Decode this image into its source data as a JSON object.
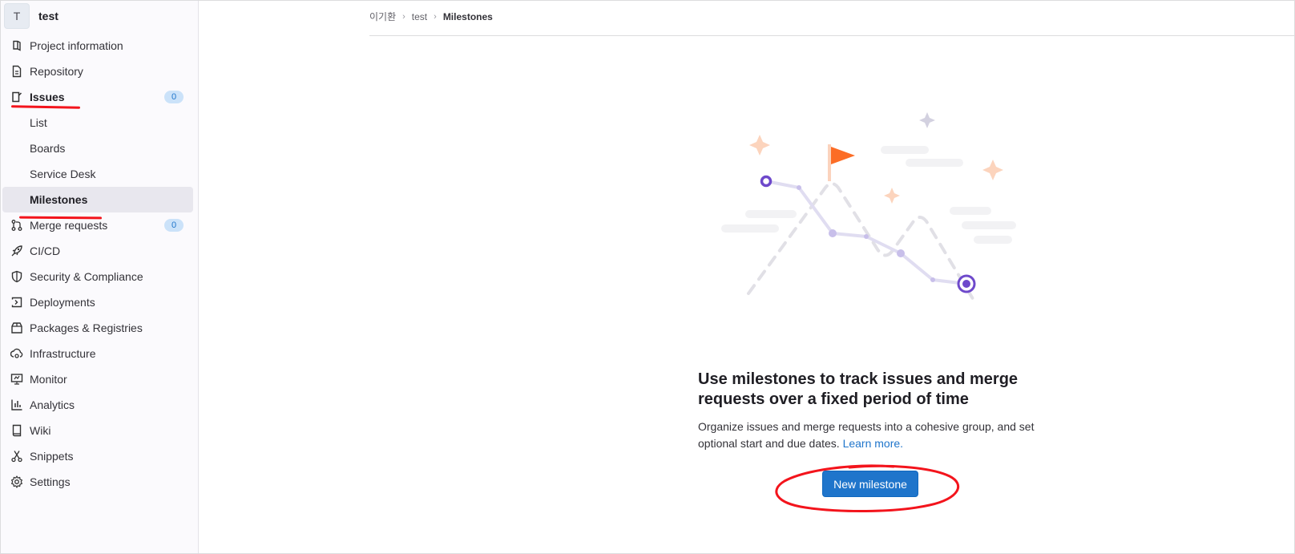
{
  "project": {
    "avatar_letter": "T",
    "name": "test"
  },
  "sidebar": {
    "items": [
      {
        "label": "Project information",
        "icon": "info-icon"
      },
      {
        "label": "Repository",
        "icon": "document-icon"
      },
      {
        "label": "Issues",
        "icon": "issues-icon",
        "badge": "0"
      },
      {
        "label": "List"
      },
      {
        "label": "Boards"
      },
      {
        "label": "Service Desk"
      },
      {
        "label": "Milestones"
      },
      {
        "label": "Merge requests",
        "icon": "merge-request-icon",
        "badge": "0"
      },
      {
        "label": "CI/CD",
        "icon": "rocket-icon"
      },
      {
        "label": "Security & Compliance",
        "icon": "shield-icon"
      },
      {
        "label": "Deployments",
        "icon": "deployments-icon"
      },
      {
        "label": "Packages & Registries",
        "icon": "package-icon"
      },
      {
        "label": "Infrastructure",
        "icon": "infrastructure-icon"
      },
      {
        "label": "Monitor",
        "icon": "monitor-icon"
      },
      {
        "label": "Analytics",
        "icon": "chart-icon"
      },
      {
        "label": "Wiki",
        "icon": "book-icon"
      },
      {
        "label": "Snippets",
        "icon": "scissors-icon"
      },
      {
        "label": "Settings",
        "icon": "gear-icon"
      }
    ]
  },
  "breadcrumb": {
    "owner": "이기환",
    "project": "test",
    "current": "Milestones"
  },
  "empty_state": {
    "title": "Use milestones to track issues and merge requests over a fixed period of time",
    "description": "Organize issues and merge requests into a cohesive group, and set optional start and due dates.",
    "learn_more": "Learn more.",
    "button": "New milestone"
  },
  "colors": {
    "accent": "#1f75cb",
    "annotation": "#f3141c",
    "flag": "#fc6d26",
    "path": "#6e49cb"
  }
}
